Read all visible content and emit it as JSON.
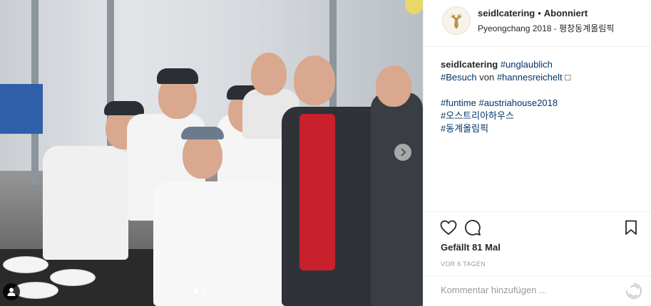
{
  "header": {
    "username": "seidlcatering",
    "separator": "•",
    "follow_state": "Abonniert",
    "location": "Pyeongchang 2018 - 평창동계올림픽"
  },
  "caption": {
    "username": "seidlcatering",
    "line1_tag": "#unglaublich",
    "line2_tag1": "#Besuch",
    "line2_word": "von",
    "line2_tag2": "#hannesreichelt",
    "line2_emoji": "□",
    "line3_tags": "#funtime #austriahouse2018",
    "line4_tag": "#오스트리아하우스",
    "line5_tag": "#동계올림픽"
  },
  "stats": {
    "likes": "Gefällt 81 Mal",
    "time_ago": "VOR 6 TAGEN"
  },
  "comment": {
    "placeholder": "Kommentar hinzufügen ..."
  },
  "icons": {
    "like": "heart-icon",
    "comment": "comment-icon",
    "save": "bookmark-icon",
    "next": "chevron-right-icon",
    "tag": "user-tag-icon",
    "more": "loading-spinner-icon"
  },
  "colors": {
    "hashtag": "#003569",
    "text": "#262626",
    "muted": "#999999",
    "divider": "#efefef"
  },
  "carousel": {
    "total": 2,
    "active": 1
  }
}
